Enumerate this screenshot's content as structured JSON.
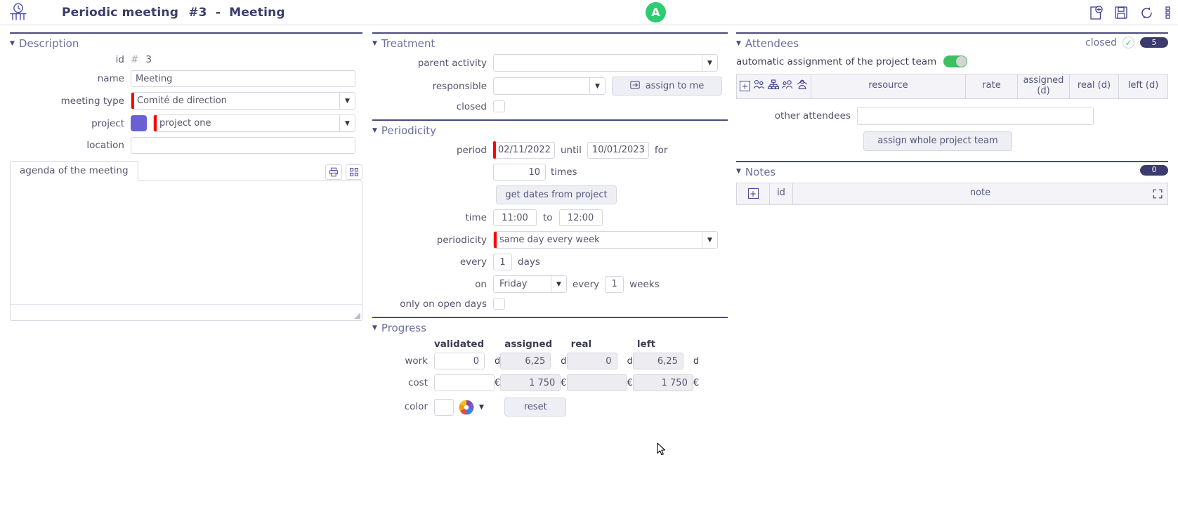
{
  "window": {
    "title_main": "Periodic meeting",
    "title_num": "#3",
    "title_sep": "-",
    "title_type": "Meeting",
    "avatar_initial": "A",
    "logo_icon": "meeting-table-clock-icon",
    "toolbar": [
      {
        "name": "new-document-icon",
        "label": "new"
      },
      {
        "name": "save-icon",
        "label": "save"
      },
      {
        "name": "refresh-icon",
        "label": "refresh"
      },
      {
        "name": "more-menu-icon",
        "label": "more"
      }
    ]
  },
  "description": {
    "title": "Description",
    "id_label": "id",
    "id_hash": "#",
    "id_value": "3",
    "name_label": "name",
    "name_value": "Meeting",
    "meeting_type_label": "meeting type",
    "meeting_type_value": "Comité de direction",
    "project_label": "project",
    "project_value": "project one",
    "project_color": "#6b5fd6",
    "location_label": "location",
    "location_value": "",
    "agenda_tab": "agenda of the meeting",
    "agenda_value": "",
    "agenda_tools": [
      {
        "name": "print-icon"
      },
      {
        "name": "fullscreen-grid-icon"
      }
    ]
  },
  "treatment": {
    "title": "Treatment",
    "parent_activity_label": "parent activity",
    "parent_activity_value": "",
    "responsible_label": "responsible",
    "responsible_value": "",
    "assign_to_me_label": "assign to me",
    "assign_to_me_icon": "assign-arrow-icon",
    "closed_label": "closed",
    "closed_checked": false
  },
  "periodicity": {
    "title": "Periodicity",
    "period_label": "period",
    "period_from": "02/11/2022",
    "until_label": "until",
    "period_to": "10/01/2023",
    "for_label": "for",
    "times_value": "10",
    "times_label": "times",
    "get_dates_label": "get dates from project",
    "time_label": "time",
    "time_from": "11:00",
    "to_label": "to",
    "time_to": "12:00",
    "periodicity_label": "periodicity",
    "periodicity_value": "same day every week",
    "every_label": "every",
    "every_days_value": "1",
    "days_label": "days",
    "on_label": "on",
    "on_day_value": "Friday",
    "every2_label": "every",
    "every_weeks_value": "1",
    "weeks_label": "weeks",
    "open_days_label": "only on open days",
    "open_days_checked": false
  },
  "progress": {
    "title": "Progress",
    "columns": [
      "validated",
      "assigned",
      "real",
      "left"
    ],
    "rows": [
      {
        "label": "work",
        "unit": "d",
        "validated": "0",
        "assigned": "6,25",
        "real": "0",
        "left": "6,25",
        "validated_readonly": false
      },
      {
        "label": "cost",
        "unit": "€",
        "validated": "",
        "assigned": "1 750",
        "real": "",
        "left": "1 750",
        "validated_readonly": false
      }
    ],
    "color_label": "color",
    "color_value": "",
    "color_picker_icon": "color-wheel-icon",
    "reset_label": "reset"
  },
  "attendees": {
    "title": "Attendees",
    "closed_label": "closed",
    "closed_checked": true,
    "badge": "5",
    "auto_assign_label": "automatic assignment of the project team",
    "auto_assign_on": true,
    "toolbar_icons": [
      {
        "name": "add-row-icon",
        "label": "+"
      },
      {
        "name": "users-group-icon"
      },
      {
        "name": "org-chart-icon"
      },
      {
        "name": "user-team-icon"
      },
      {
        "name": "resource-crane-icon"
      }
    ],
    "columns": [
      "resource",
      "rate",
      "assigned (d)",
      "real (d)",
      "left (d)"
    ],
    "other_attendees_label": "other attendees",
    "other_attendees_value": "",
    "assign_team_label": "assign whole project team"
  },
  "notes": {
    "title": "Notes",
    "badge": "0",
    "columns": [
      "id",
      "note"
    ],
    "add_icon": "add-row-icon",
    "expand_icon": "expand-fullscreen-icon"
  },
  "colors": {
    "accent": "#3b3b6d",
    "section_title": "#6f6f9e",
    "required": "#ff0000",
    "toggle_on": "#3fbf63",
    "avatar": "#2ecc71",
    "project_swatch": "#6b5fd6"
  }
}
